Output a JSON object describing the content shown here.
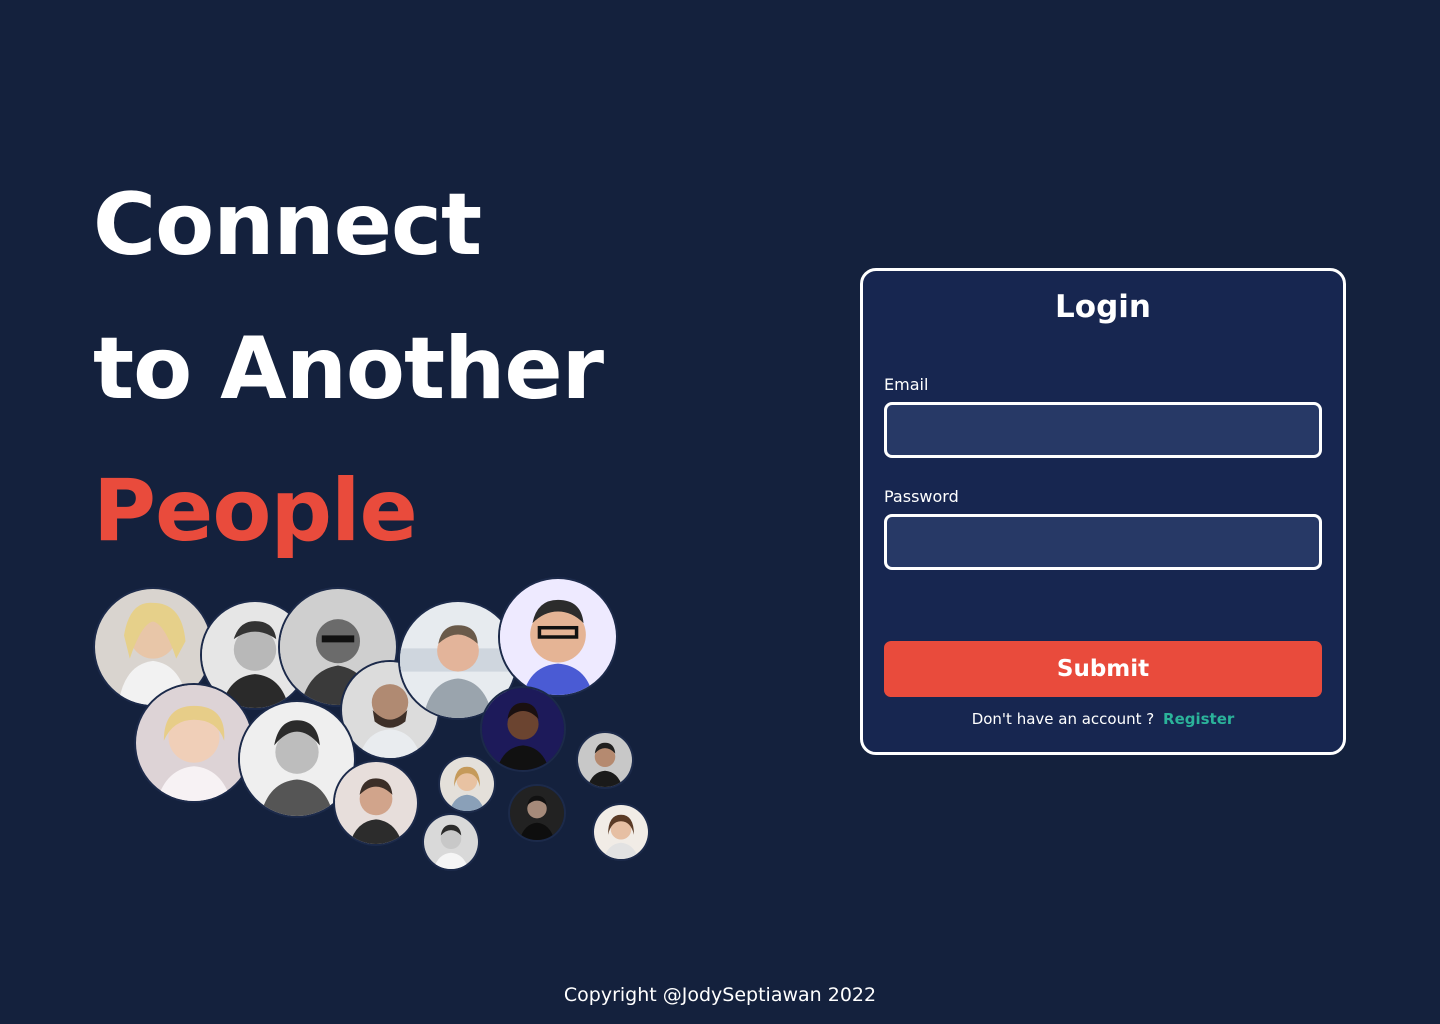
{
  "hero": {
    "line1": "Connect",
    "line2": "to Another",
    "line3": "People"
  },
  "colors": {
    "background": "#14213d",
    "card": "#172650",
    "input": "#273966",
    "accent": "#e94b3c",
    "link": "#2bb39a"
  },
  "login": {
    "title": "Login",
    "email_label": "Email",
    "email_value": "",
    "password_label": "Password",
    "password_value": "",
    "submit_label": "Submit",
    "register_prompt": "Don't have an account ?",
    "register_link": "Register"
  },
  "avatars": [
    {
      "icon": "avatar-photo-1"
    },
    {
      "icon": "avatar-photo-2"
    },
    {
      "icon": "avatar-photo-3"
    },
    {
      "icon": "avatar-photo-4"
    },
    {
      "icon": "avatar-photo-5"
    },
    {
      "icon": "avatar-photo-6"
    },
    {
      "icon": "avatar-photo-7"
    },
    {
      "icon": "avatar-photo-8"
    },
    {
      "icon": "avatar-photo-9"
    },
    {
      "icon": "avatar-photo-10"
    },
    {
      "icon": "avatar-photo-11"
    },
    {
      "icon": "avatar-photo-12"
    },
    {
      "icon": "avatar-photo-13"
    },
    {
      "icon": "avatar-photo-14"
    },
    {
      "icon": "avatar-photo-15"
    },
    {
      "icon": "avatar-photo-16"
    }
  ],
  "footer": {
    "copyright": "Copyright @JodySeptiawan 2022"
  }
}
